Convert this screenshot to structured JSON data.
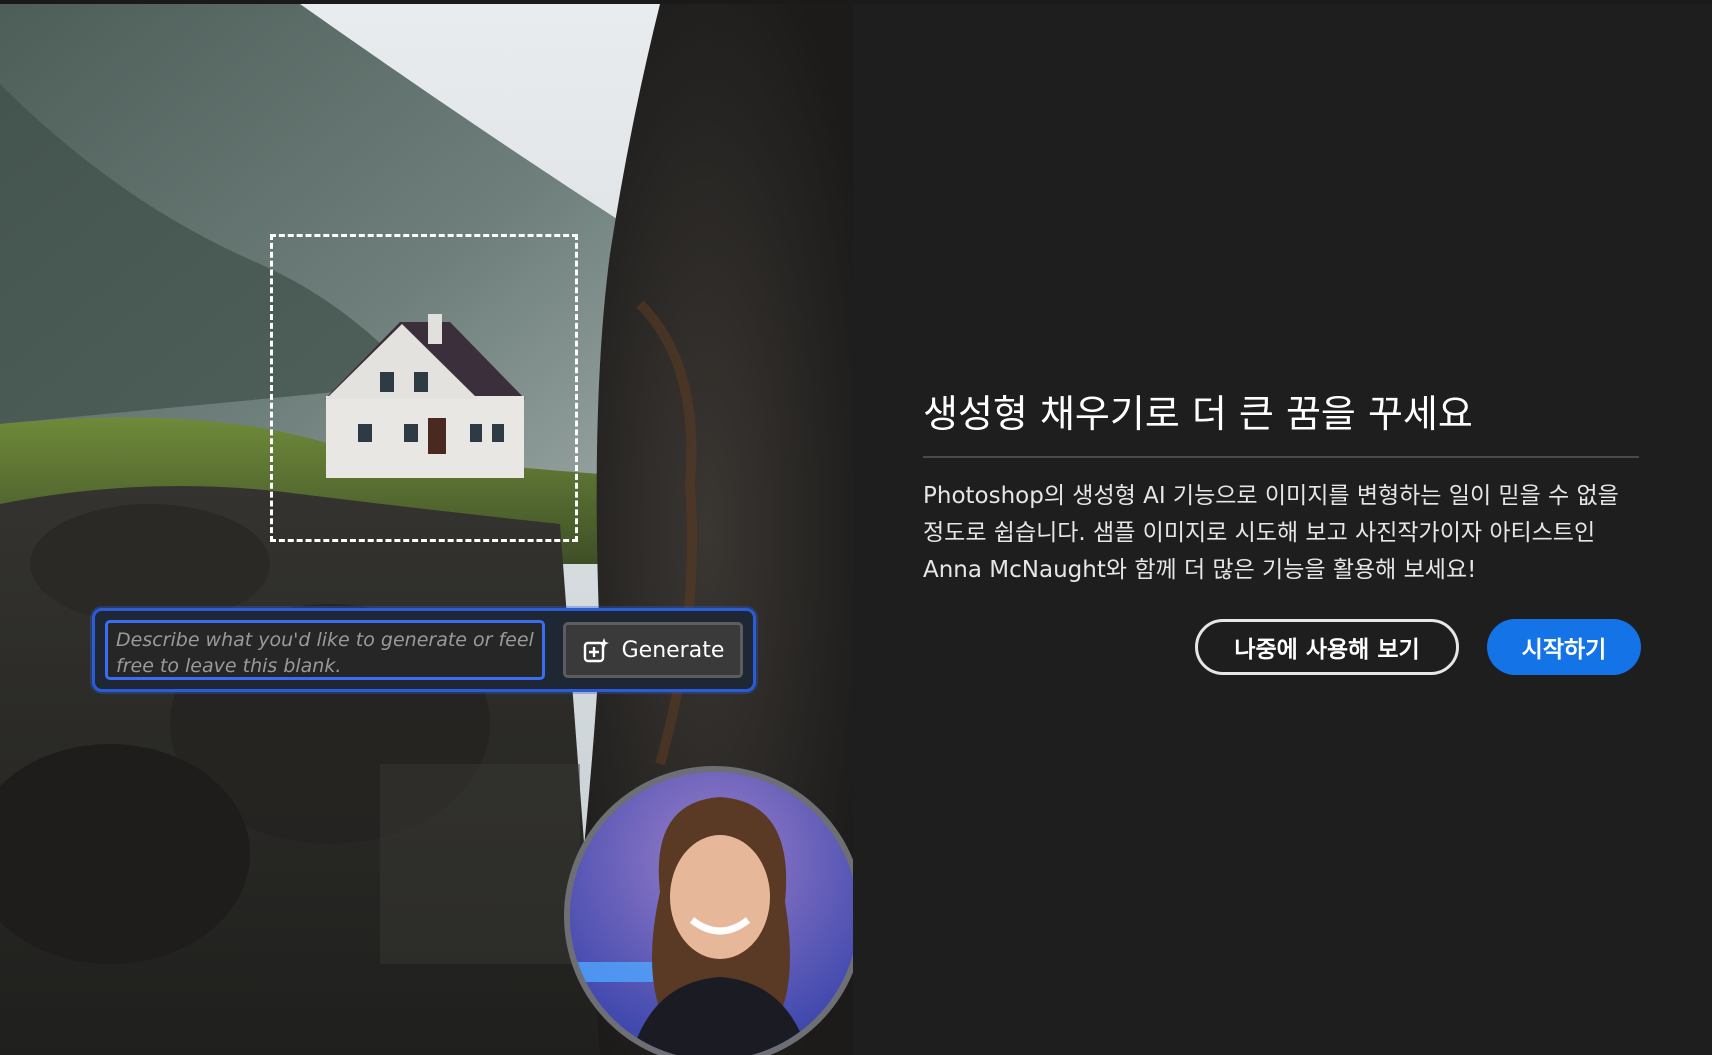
{
  "dialog": {
    "title": "생성형 채우기로 더 큰 꿈을 꾸세요",
    "description": "Photoshop의 생성형 AI 기능으로 이미지를 변형하는 일이 믿을 수 없을 정도로 쉽습니다. 샘플 이미지로 시도해 보고 사진작가이자 아티스트인 Anna McNaught와 함께 더 많은 기능을 활용해 보세요!",
    "later_label": "나중에 사용해 보기",
    "start_label": "시작하기"
  },
  "illustration": {
    "prompt_placeholder": "Describe what you'd like to generate or feel free to leave this blank.",
    "generate_label": "Generate",
    "generate_icon": "generative-fill-icon"
  },
  "colors": {
    "background": "#1e1e1e",
    "accent": "#1473e6",
    "prompt_highlight": "#2b5cd3"
  }
}
